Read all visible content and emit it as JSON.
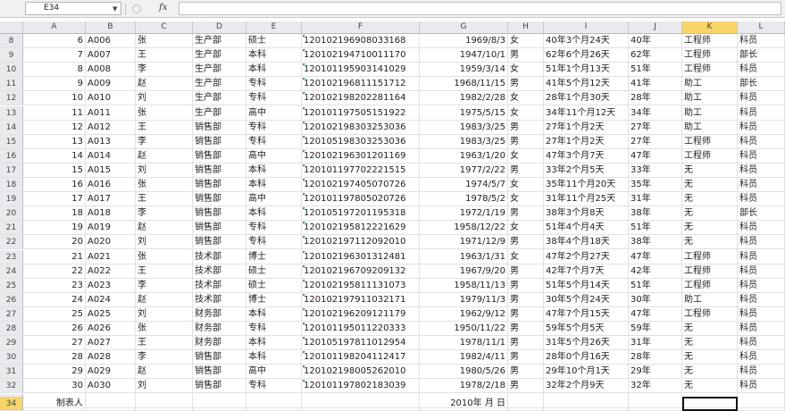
{
  "formula_bar": {
    "name_box": "E34",
    "formula": ""
  },
  "columns": [
    "A",
    "B",
    "C",
    "D",
    "E",
    "F",
    "G",
    "H",
    "I",
    "J",
    "K",
    "L"
  ],
  "selected_column": "K",
  "rows": [
    {
      "n": "8",
      "a": "6",
      "b": "A006",
      "c": "张",
      "d": "生产部",
      "e": "硕士",
      "f": "120102196908033168",
      "g": "1969/8/3",
      "h": "女",
      "i": "40年3个月24天",
      "j": "40年",
      "k": "工程师",
      "l": "科员"
    },
    {
      "n": "9",
      "a": "7",
      "b": "A007",
      "c": "王",
      "d": "生产部",
      "e": "本科",
      "f": "120102194710011170",
      "g": "1947/10/1",
      "h": "男",
      "i": "62年6个月26天",
      "j": "62年",
      "k": "工程师",
      "l": "部长"
    },
    {
      "n": "10",
      "a": "8",
      "b": "A008",
      "c": "李",
      "d": "生产部",
      "e": "本科",
      "f": "120101195903141029",
      "g": "1959/3/14",
      "h": "女",
      "i": "51年1个月13天",
      "j": "51年",
      "k": "工程师",
      "l": "科员"
    },
    {
      "n": "11",
      "a": "9",
      "b": "A009",
      "c": "赵",
      "d": "生产部",
      "e": "专科",
      "f": "120102196811151712",
      "g": "1968/11/15",
      "h": "男",
      "i": "41年5个月12天",
      "j": "41年",
      "k": "助工",
      "l": "部长"
    },
    {
      "n": "12",
      "a": "10",
      "b": "A010",
      "c": "刘",
      "d": "生产部",
      "e": "专科",
      "f": "120102198202281164",
      "g": "1982/2/28",
      "h": "女",
      "i": "28年1个月30天",
      "j": "28年",
      "k": "助工",
      "l": "科员"
    },
    {
      "n": "13",
      "a": "11",
      "b": "A011",
      "c": "张",
      "d": "生产部",
      "e": "高中",
      "f": "120101197505151922",
      "g": "1975/5/15",
      "h": "女",
      "i": "34年11个月12天",
      "j": "34年",
      "k": "助工",
      "l": "科员"
    },
    {
      "n": "14",
      "a": "12",
      "b": "A012",
      "c": "王",
      "d": "销售部",
      "e": "专科",
      "f": "120102198303253036",
      "g": "1983/3/25",
      "h": "男",
      "i": "27年1个月2天",
      "j": "27年",
      "k": "助工",
      "l": "科员"
    },
    {
      "n": "15",
      "a": "13",
      "b": "A013",
      "c": "李",
      "d": "销售部",
      "e": "专科",
      "f": "120105198303253036",
      "g": "1983/3/25",
      "h": "男",
      "i": "27年1个月2天",
      "j": "27年",
      "k": "工程师",
      "l": "科员"
    },
    {
      "n": "16",
      "a": "14",
      "b": "A014",
      "c": "赵",
      "d": "销售部",
      "e": "高中",
      "f": "120102196301201169",
      "g": "1963/1/20",
      "h": "女",
      "i": "47年3个月7天",
      "j": "47年",
      "k": "工程师",
      "l": "科员"
    },
    {
      "n": "17",
      "a": "15",
      "b": "A015",
      "c": "刘",
      "d": "销售部",
      "e": "本科",
      "f": "120101197702221515",
      "g": "1977/2/22",
      "h": "男",
      "i": "33年2个月5天",
      "j": "33年",
      "k": "无",
      "l": "科员"
    },
    {
      "n": "18",
      "a": "16",
      "b": "A016",
      "c": "张",
      "d": "销售部",
      "e": "本科",
      "f": "120102197405070726",
      "g": "1974/5/7",
      "h": "女",
      "i": "35年11个月20天",
      "j": "35年",
      "k": "无",
      "l": "科员"
    },
    {
      "n": "19",
      "a": "17",
      "b": "A017",
      "c": "王",
      "d": "销售部",
      "e": "高中",
      "f": "120101197805020726",
      "g": "1978/5/2",
      "h": "女",
      "i": "31年11个月25天",
      "j": "31年",
      "k": "无",
      "l": "科员"
    },
    {
      "n": "20",
      "a": "18",
      "b": "A018",
      "c": "李",
      "d": "销售部",
      "e": "本科",
      "f": "120105197201195318",
      "g": "1972/1/19",
      "h": "男",
      "i": "38年3个月8天",
      "j": "38年",
      "k": "无",
      "l": "部长"
    },
    {
      "n": "21",
      "a": "19",
      "b": "A019",
      "c": "赵",
      "d": "销售部",
      "e": "专科",
      "f": "120102195812221629",
      "g": "1958/12/22",
      "h": "女",
      "i": "51年4个月4天",
      "j": "51年",
      "k": "无",
      "l": "科员"
    },
    {
      "n": "22",
      "a": "20",
      "b": "A020",
      "c": "刘",
      "d": "销售部",
      "e": "专科",
      "f": "120102197112092010",
      "g": "1971/12/9",
      "h": "男",
      "i": "38年4个月18天",
      "j": "38年",
      "k": "无",
      "l": "科员"
    },
    {
      "n": "23",
      "a": "21",
      "b": "A021",
      "c": "张",
      "d": "技术部",
      "e": "博士",
      "f": "120102196301312481",
      "g": "1963/1/31",
      "h": "女",
      "i": "47年2个月27天",
      "j": "47年",
      "k": "工程师",
      "l": "科员"
    },
    {
      "n": "24",
      "a": "22",
      "b": "A022",
      "c": "王",
      "d": "技术部",
      "e": "硕士",
      "f": "120102196709209132",
      "g": "1967/9/20",
      "h": "男",
      "i": "42年7个月7天",
      "j": "42年",
      "k": "工程师",
      "l": "科员"
    },
    {
      "n": "25",
      "a": "23",
      "b": "A023",
      "c": "李",
      "d": "技术部",
      "e": "硕士",
      "f": "120102195811131073",
      "g": "1958/11/13",
      "h": "男",
      "i": "51年5个月14天",
      "j": "51年",
      "k": "工程师",
      "l": "科员"
    },
    {
      "n": "26",
      "a": "24",
      "b": "A024",
      "c": "赵",
      "d": "技术部",
      "e": "博士",
      "f": "120102197911032171",
      "g": "1979/11/3",
      "h": "男",
      "i": "30年5个月24天",
      "j": "30年",
      "k": "助工",
      "l": "科员"
    },
    {
      "n": "27",
      "a": "25",
      "b": "A025",
      "c": "刘",
      "d": "财务部",
      "e": "本科",
      "f": "120102196209121179",
      "g": "1962/9/12",
      "h": "男",
      "i": "47年7个月15天",
      "j": "47年",
      "k": "工程师",
      "l": "科员"
    },
    {
      "n": "28",
      "a": "26",
      "b": "A026",
      "c": "张",
      "d": "财务部",
      "e": "专科",
      "f": "120101195011220333",
      "g": "1950/11/22",
      "h": "男",
      "i": "59年5个月5天",
      "j": "59年",
      "k": "无",
      "l": "科员"
    },
    {
      "n": "29",
      "a": "27",
      "b": "A027",
      "c": "王",
      "d": "财务部",
      "e": "本科",
      "f": "120105197811012954",
      "g": "1978/11/1",
      "h": "男",
      "i": "31年5个月26天",
      "j": "31年",
      "k": "无",
      "l": "科员"
    },
    {
      "n": "30",
      "a": "28",
      "b": "A028",
      "c": "李",
      "d": "销售部",
      "e": "本科",
      "f": "120101198204112417",
      "g": "1982/4/11",
      "h": "男",
      "i": "28年0个月16天",
      "j": "28年",
      "k": "无",
      "l": "科员"
    },
    {
      "n": "31",
      "a": "29",
      "b": "A029",
      "c": "赵",
      "d": "销售部",
      "e": "高中",
      "f": "120102198005262010",
      "g": "1980/5/26",
      "h": "男",
      "i": "29年10个月1天",
      "j": "29年",
      "k": "无",
      "l": "科员"
    },
    {
      "n": "32",
      "a": "30",
      "b": "A030",
      "c": "刘",
      "d": "销售部",
      "e": "专科",
      "f": "120101197802183039",
      "g": "1978/2/18",
      "h": "男",
      "i": "32年2个月9天",
      "j": "32年",
      "k": "无",
      "l": "科员"
    }
  ],
  "footer_row": {
    "n": "34",
    "a": "制表人",
    "g": "2010年  月  日"
  }
}
